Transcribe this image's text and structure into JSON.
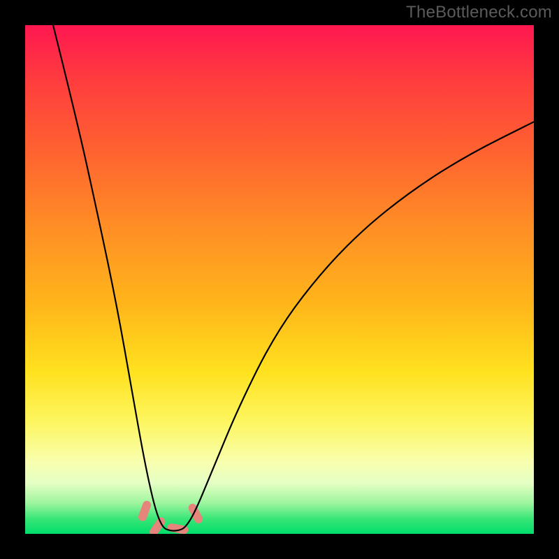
{
  "watermark": "TheBottleneck.com",
  "colors": {
    "frame": "#000000",
    "curve": "#000000",
    "marker": "#e6857b",
    "gradient_stops": [
      "#ff1750",
      "#ff3a3f",
      "#ff6330",
      "#ff8f25",
      "#ffb61a",
      "#ffe11e",
      "#fdf660",
      "#f8ffb0",
      "#e5ffc4",
      "#9cf59d",
      "#3ae678",
      "#00dd6a"
    ]
  },
  "chart_data": {
    "type": "line",
    "title": "",
    "xlabel": "",
    "ylabel": "",
    "description": "Bottleneck curve: deep V shape. Left branch starts near top-left, plunges to a flat minimum around x≈0.28, then rises with a long convex curve toward upper right. Background heat map gradient from red (top) to green (bottom). Four short pink markers near the trough.",
    "x_range": [
      0,
      1
    ],
    "y_range": [
      0,
      1
    ],
    "series": [
      {
        "name": "bottleneck-curve",
        "points": [
          {
            "x": 0.055,
            "y": 1.0
          },
          {
            "x": 0.1,
            "y": 0.82
          },
          {
            "x": 0.14,
            "y": 0.64
          },
          {
            "x": 0.18,
            "y": 0.45
          },
          {
            "x": 0.21,
            "y": 0.28
          },
          {
            "x": 0.235,
            "y": 0.14
          },
          {
            "x": 0.255,
            "y": 0.05
          },
          {
            "x": 0.27,
            "y": 0.012
          },
          {
            "x": 0.285,
            "y": 0.006
          },
          {
            "x": 0.3,
            "y": 0.006
          },
          {
            "x": 0.315,
            "y": 0.012
          },
          {
            "x": 0.335,
            "y": 0.045
          },
          {
            "x": 0.37,
            "y": 0.13
          },
          {
            "x": 0.42,
            "y": 0.25
          },
          {
            "x": 0.49,
            "y": 0.39
          },
          {
            "x": 0.57,
            "y": 0.5
          },
          {
            "x": 0.66,
            "y": 0.595
          },
          {
            "x": 0.76,
            "y": 0.675
          },
          {
            "x": 0.87,
            "y": 0.745
          },
          {
            "x": 1.0,
            "y": 0.81
          }
        ]
      }
    ],
    "markers": [
      {
        "x": 0.235,
        "y": 0.045,
        "angle": -70
      },
      {
        "x": 0.26,
        "y": 0.014,
        "angle": -55
      },
      {
        "x": 0.3,
        "y": 0.01,
        "angle": 10
      },
      {
        "x": 0.335,
        "y": 0.04,
        "angle": 62
      }
    ]
  }
}
